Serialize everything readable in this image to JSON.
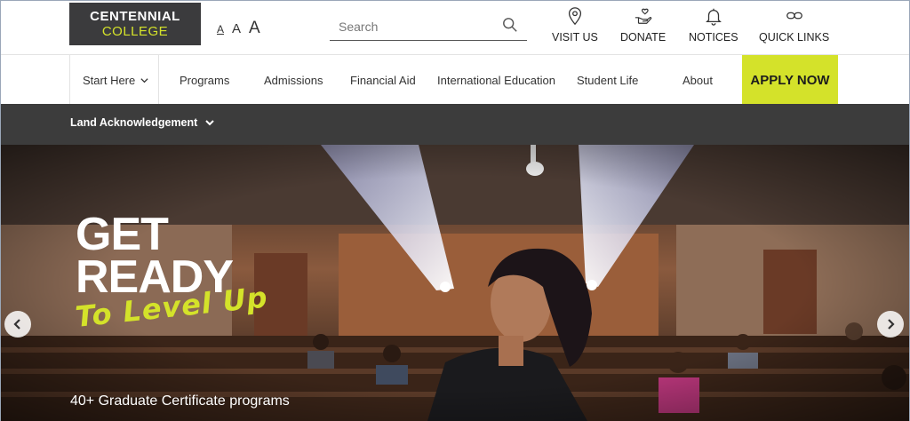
{
  "logo": {
    "line1": "CENTENNIAL",
    "line2": "COLLEGE"
  },
  "font_size": {
    "small": "A",
    "medium": "A",
    "large": "A"
  },
  "search": {
    "placeholder": "Search"
  },
  "quick_links": [
    {
      "label": "VISIT US",
      "icon": "location-pin-icon"
    },
    {
      "label": "DONATE",
      "icon": "donate-hand-heart-icon"
    },
    {
      "label": "NOTICES",
      "icon": "bell-icon"
    },
    {
      "label": "QUICK LINKS",
      "icon": "link-icon"
    }
  ],
  "nav": {
    "start_here": "Start Here",
    "programs": "Programs",
    "admissions": "Admissions",
    "financial_aid": "Financial Aid",
    "international": "International Education",
    "student_life": "Student Life",
    "about": "About",
    "apply": "APPLY NOW"
  },
  "land_ack": {
    "label": "Land Acknowledgement"
  },
  "hero": {
    "line1": "GET",
    "line2": "READY",
    "line3": "To Level Up",
    "caption": "40+ Graduate Certificate programs"
  },
  "colors": {
    "brand_dark": "#3b3b3d",
    "accent": "#d4e22a",
    "bar": "#3c3c3c"
  }
}
